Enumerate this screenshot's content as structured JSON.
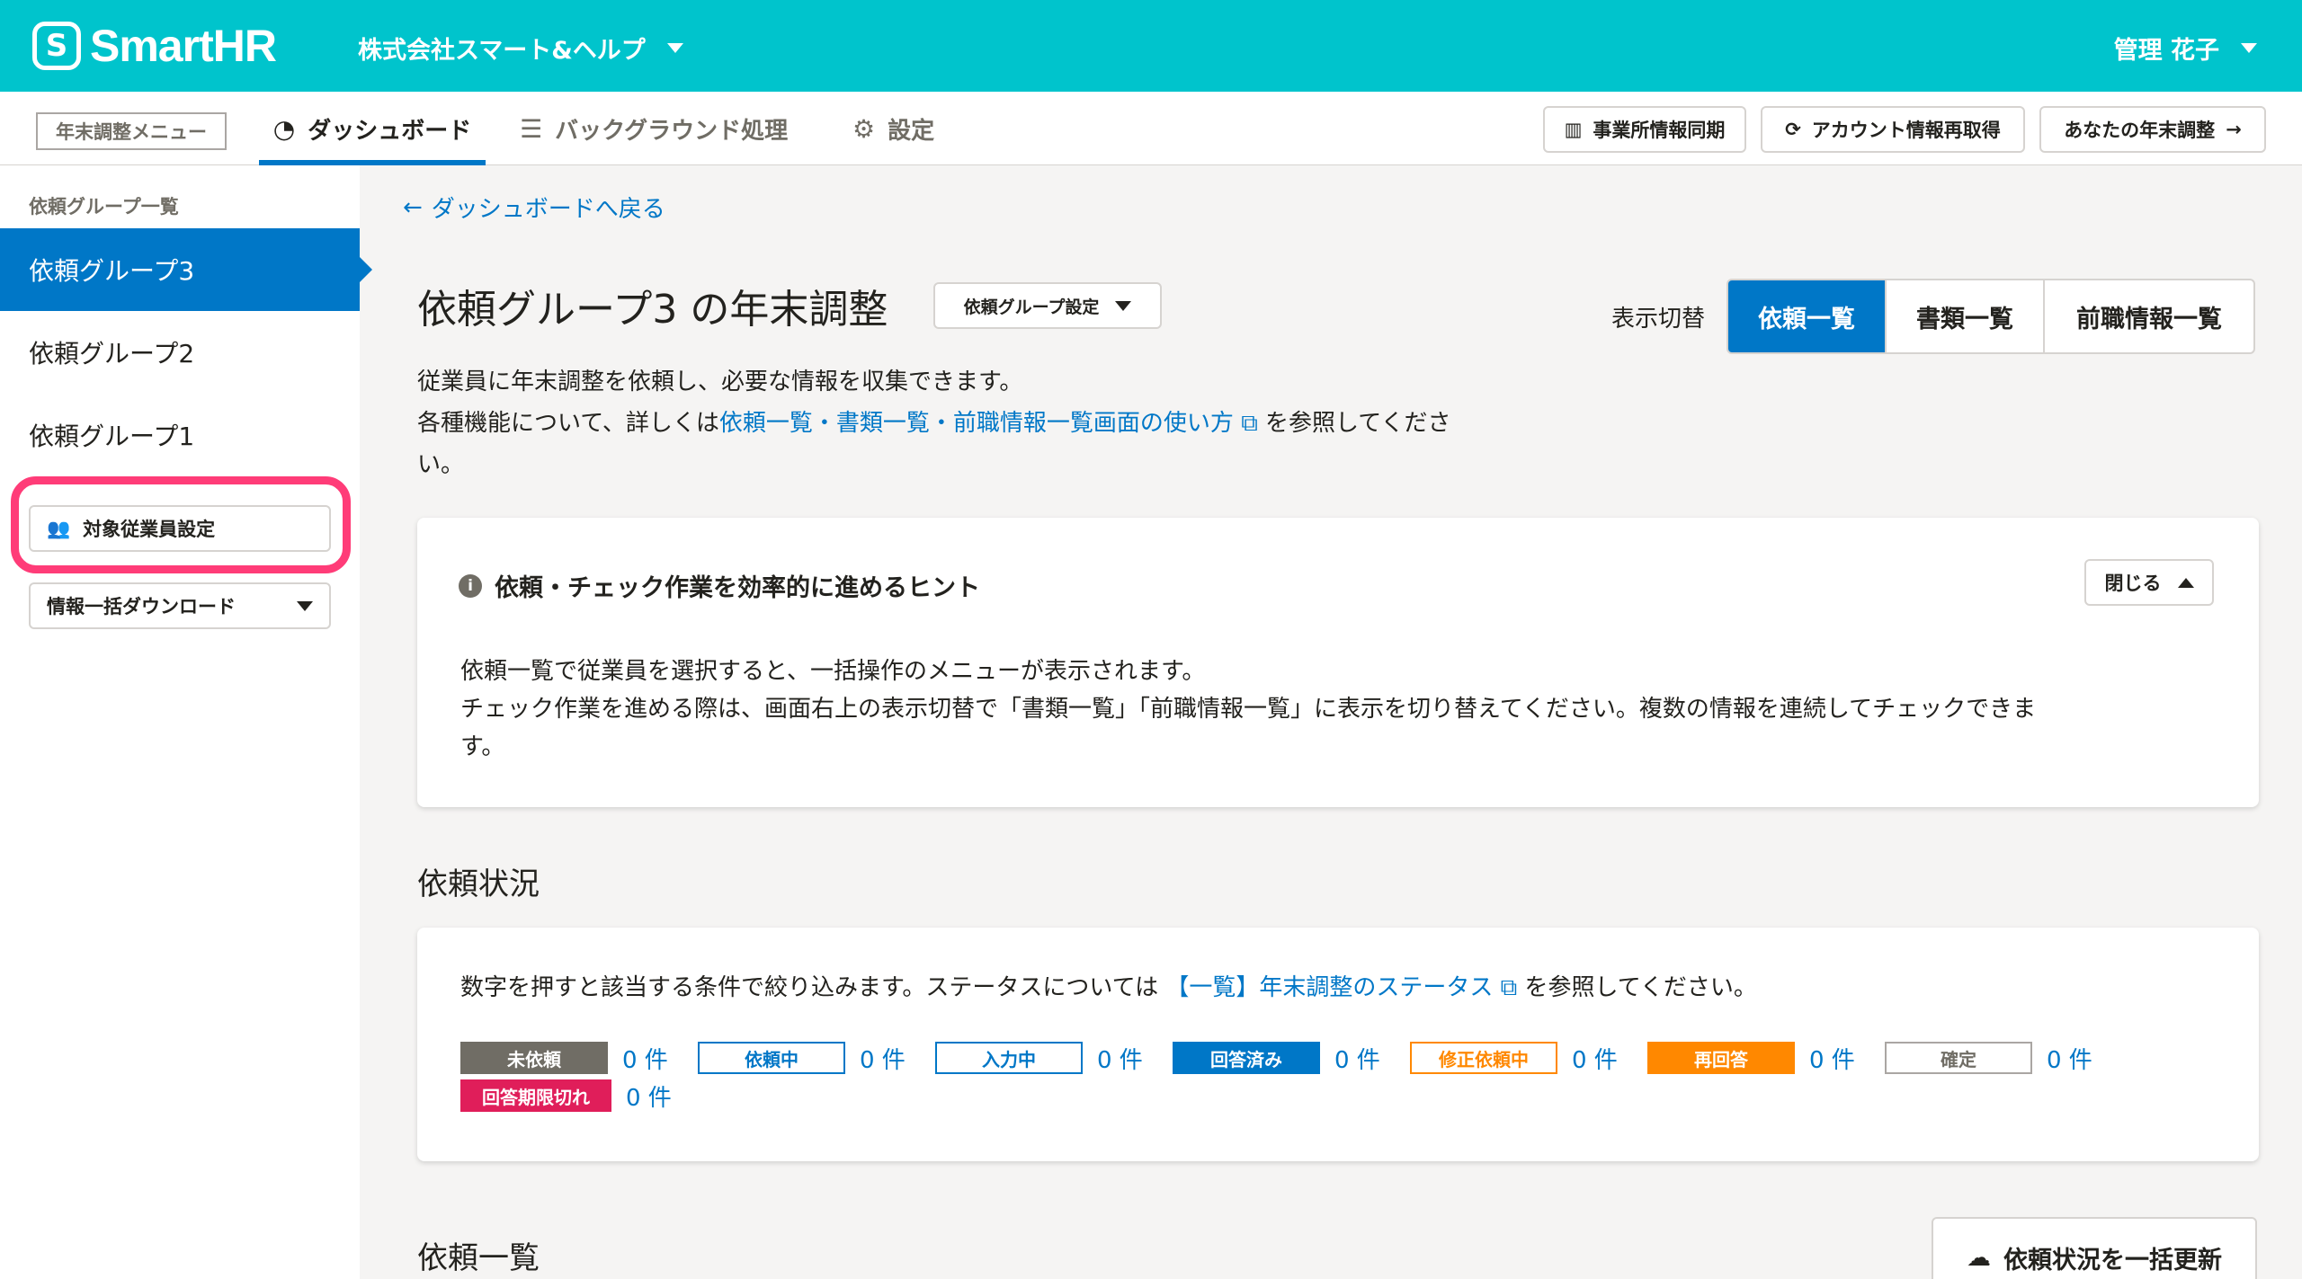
{
  "header": {
    "logo_text": "SmartHR",
    "company": "株式会社スマート&ヘルプ",
    "user": "管理 花子"
  },
  "subnav": {
    "menu_tag": "年末調整メニュー",
    "tabs": [
      {
        "label": "ダッシュボード",
        "active": true
      },
      {
        "label": "バックグラウンド処理",
        "active": false
      },
      {
        "label": "設定",
        "active": false
      }
    ],
    "buttons": {
      "sync": "事業所情報同期",
      "account": "アカウント情報再取得",
      "my_adjust": "あなたの年末調整"
    }
  },
  "sidebar": {
    "title": "依頼グループ一覧",
    "groups": [
      {
        "label": "依頼グループ3",
        "active": true
      },
      {
        "label": "依頼グループ2",
        "active": false
      },
      {
        "label": "依頼グループ1",
        "active": false
      }
    ],
    "target_btn": "対象従業員設定",
    "download_btn": "情報一括ダウンロード"
  },
  "main": {
    "back_link": "ダッシュボードへ戻る",
    "title": "依頼グループ3 の年末調整",
    "group_setting": "依頼グループ設定",
    "view_label": "表示切替",
    "views": [
      {
        "label": "依頼一覧",
        "active": true
      },
      {
        "label": "書類一覧",
        "active": false
      },
      {
        "label": "前職情報一覧",
        "active": false
      }
    ],
    "desc_line1": "従業員に年末調整を依頼し、必要な情報を収集できます。",
    "desc_pre": "各種機能について、詳しくは",
    "desc_link": "依頼一覧・書類一覧・前職情報一覧画面の使い方",
    "desc_post": "を参照してくださ",
    "desc_wrap": "い。",
    "hint": {
      "title": "依頼・チェック作業を効率的に進めるヒント",
      "close": "閉じる",
      "line1": "依頼一覧で従業員を選択すると、一括操作のメニューが表示されます。",
      "line2": "チェック作業を進める際は、画面右上の表示切替で「書類一覧」「前職情報一覧」に表示を切り替えてください。複数の情報を連続してチェックできま",
      "line3": "す。"
    },
    "status_title": "依頼状況",
    "status_pre": "数字を押すと該当する条件で絞り込みます。ステータスについては",
    "status_link": "【一覧】年末調整のステータス",
    "status_post": "を参照してください。",
    "statuses": [
      {
        "label": "未依頼",
        "count": "0 件"
      },
      {
        "label": "依頼中",
        "count": "0 件"
      },
      {
        "label": "入力中",
        "count": "0 件"
      },
      {
        "label": "回答済み",
        "count": "0 件"
      },
      {
        "label": "修正依頼中",
        "count": "0 件"
      },
      {
        "label": "再回答",
        "count": "0 件"
      },
      {
        "label": "確定",
        "count": "0 件"
      },
      {
        "label": "回答期限切れ",
        "count": "0 件"
      }
    ],
    "list_title": "依頼一覧",
    "bulk_update": "依頼状況を一括更新"
  },
  "colors": {
    "brand": "#00c4cc",
    "primary": "#0077c7",
    "highlight": "#ff3c78"
  }
}
